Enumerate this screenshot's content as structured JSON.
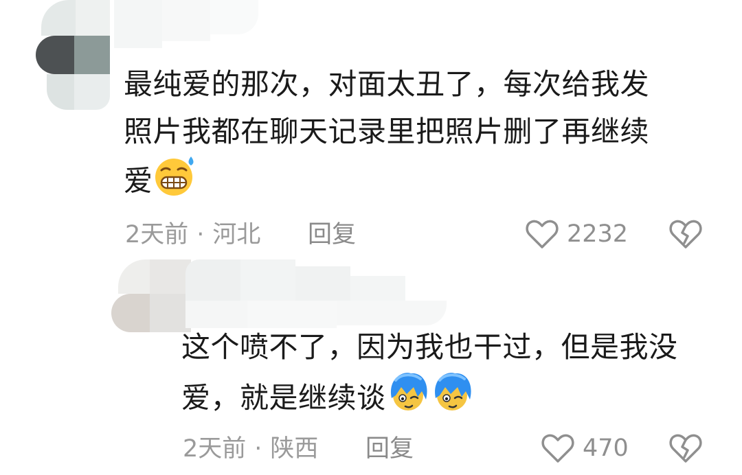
{
  "comments": [
    {
      "text_lines": [
        "最纯爱的那次，对面太丑了，每次给我发",
        "照片我都在聊天记录里把照片删了再继续",
        "爱"
      ],
      "emoji": "grimacing-sweat-emoji",
      "time": "2天前",
      "location": "河北",
      "separator": "·",
      "reply_label": "回复",
      "likes": "2232"
    },
    {
      "text_lines": [
        "这个喷不了，因为我也干过，但是我没",
        "爱，就是继续谈"
      ],
      "emoji": "blue-hair-face-emoji",
      "time": "2天前",
      "location": "陕西",
      "separator": "·",
      "reply_label": "回复",
      "likes": "470"
    }
  ],
  "colors": {
    "text": "#1a1a1a",
    "meta": "#9a9a9a",
    "icon": "#8f8f8f"
  }
}
